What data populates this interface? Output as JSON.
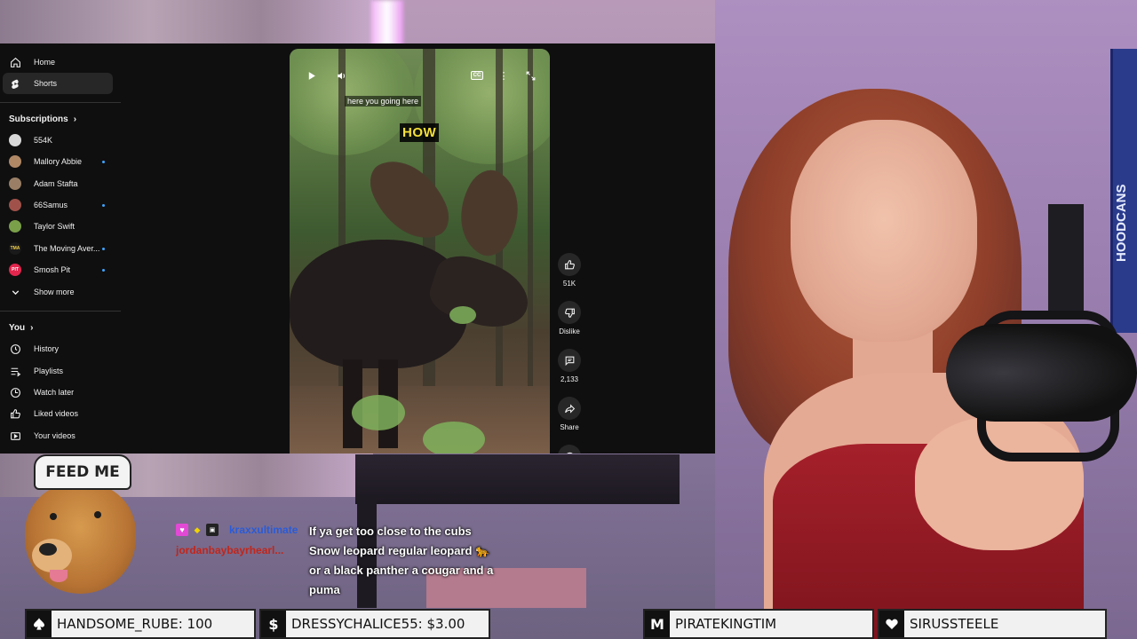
{
  "sidebar": {
    "top": [
      {
        "label": "Home",
        "icon": "home-icon"
      },
      {
        "label": "Shorts",
        "icon": "shorts-icon"
      }
    ],
    "subscriptions_title": "Subscriptions",
    "subscriptions": [
      {
        "label": "554K",
        "color": "#d8d8d8",
        "initials": ""
      },
      {
        "label": "Mallory Abbie",
        "color": "#b08866",
        "initials": ""
      },
      {
        "label": "Adam Stafta",
        "color": "#9a7f66",
        "initials": ""
      },
      {
        "label": "66Samus",
        "color": "#a0524a",
        "initials": ""
      },
      {
        "label": "Taylor Swift",
        "color": "#7aa04a",
        "initials": ""
      },
      {
        "label": "The Moving Aver...",
        "color": "#1a1a1a",
        "initials": "TMA"
      },
      {
        "label": "Smosh Pit",
        "color": "#e2264d",
        "initials": "PIT"
      }
    ],
    "show_more": "Show more",
    "you_title": "You",
    "you_items": [
      {
        "label": "History",
        "icon": "history-icon"
      },
      {
        "label": "Playlists",
        "icon": "playlists-icon"
      },
      {
        "label": "Watch later",
        "icon": "watch-later-icon"
      },
      {
        "label": "Liked videos",
        "icon": "liked-videos-icon"
      },
      {
        "label": "Your videos",
        "icon": "your-videos-icon"
      }
    ]
  },
  "video": {
    "caption_small": "here you going here",
    "caption_big": "HOW",
    "cc_label": "CC"
  },
  "actions": {
    "likes": "51K",
    "dislike": "Dislike",
    "comments": "2,133",
    "share": "Share"
  },
  "overlay": {
    "dog_hat_text": "FEED ME"
  },
  "chat": {
    "user1": "kraxxultimate",
    "user2": "jordanbaybayrhearl...",
    "message_lines": [
      "If ya get too close to the cubs",
      "Snow leopard regular leopard 🐆",
      "or a black panther a cougar and a",
      "puma"
    ]
  },
  "ticker": [
    {
      "icon": "spade-icon",
      "text": "HANDSOME_RUBE: 100"
    },
    {
      "icon": "dollar-icon",
      "text": "DRESSYCHALICE55: $3.00"
    },
    {
      "icon": "m-icon",
      "text": "PIRATEKINGTIM"
    },
    {
      "icon": "heart-icon",
      "text": "SIRUSSTEELE"
    }
  ],
  "background": {
    "banner_text": "HOODCANS"
  }
}
